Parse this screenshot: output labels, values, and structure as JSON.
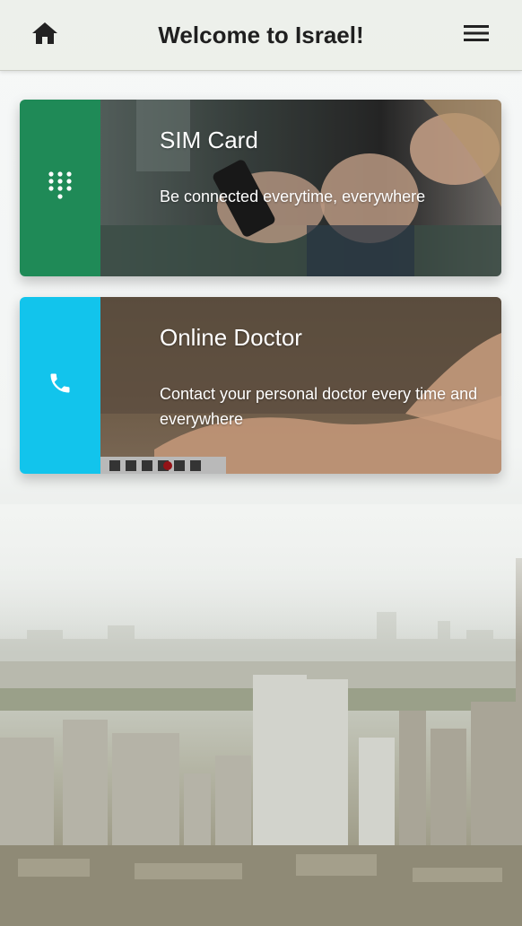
{
  "header": {
    "title": "Welcome to Israel!",
    "home_icon": "home-icon",
    "menu_icon": "hamburger-menu-icon"
  },
  "cards": [
    {
      "title": "SIM Card",
      "description": "Be connected everytime, everywhere",
      "icon": "dialpad-icon",
      "accent_color": "#1f8a57"
    },
    {
      "title": "Online Doctor",
      "description": "Contact your personal doctor every time and everywhere",
      "icon": "phone-icon",
      "accent_color": "#12c4ec"
    }
  ],
  "colors": {
    "header_bg": "#eceee8",
    "title_text": "#1f1f1f",
    "card_text": "#ffffff"
  }
}
